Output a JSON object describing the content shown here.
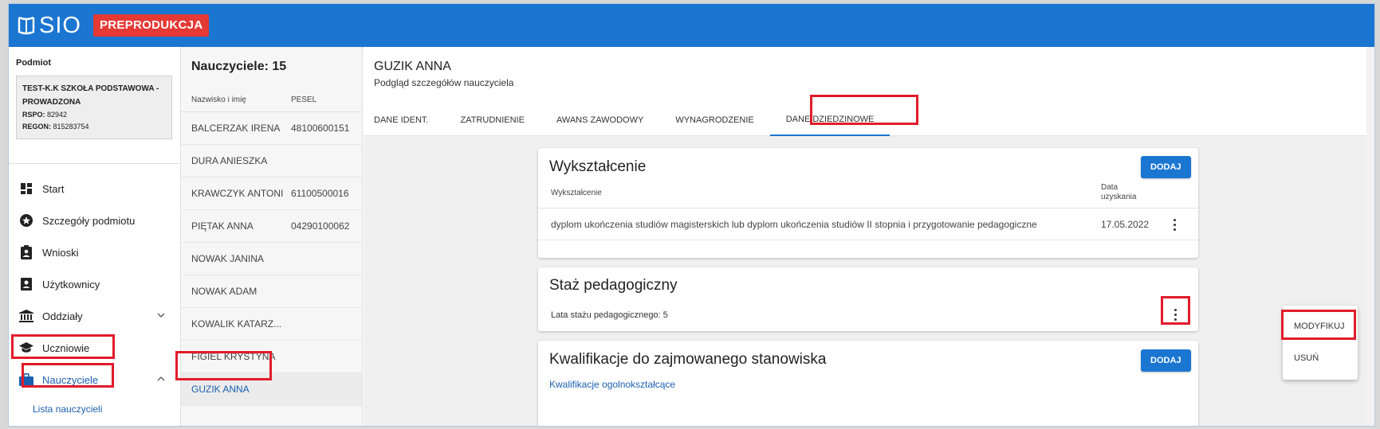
{
  "app": {
    "name": "SIO",
    "environment": "PREPRODUKCJA"
  },
  "sidebar": {
    "podmiot_label": "Podmiot",
    "school_name": "TEST-K.K SZKOŁA PODSTAWOWA - PROWADZONA",
    "rspo_label": "RSPO:",
    "rspo_value": "82942",
    "regon_label": "REGON:",
    "regon_value": "815283754",
    "items": [
      {
        "label": "Start",
        "icon": "dashboard-icon"
      },
      {
        "label": "Szczegóły podmiotu",
        "icon": "star-badge-icon"
      },
      {
        "label": "Wnioski",
        "icon": "clipboard-icon"
      },
      {
        "label": "Użytkownicy",
        "icon": "contact-card-icon"
      },
      {
        "label": "Oddziały",
        "icon": "institution-icon",
        "expandable": true
      },
      {
        "label": "Uczniowie",
        "icon": "graduation-cap-icon"
      },
      {
        "label": "Nauczyciele",
        "icon": "briefcase-icon",
        "expanded": true
      }
    ],
    "subitem": "Lista nauczycieli"
  },
  "teacher_list": {
    "title": "Nauczyciele: 15",
    "col_name": "Nazwisko i imię",
    "col_pesel": "PESEL",
    "rows": [
      {
        "name": "BALCERZAK IRENA",
        "pesel": "48100600151"
      },
      {
        "name": "DURA ANIESZKA",
        "pesel": ""
      },
      {
        "name": "KRAWCZYK ANTONI",
        "pesel": "61100500016"
      },
      {
        "name": "PIĘTAK ANNA",
        "pesel": "04290100062"
      },
      {
        "name": "NOWAK JANINA",
        "pesel": ""
      },
      {
        "name": "NOWAK ADAM",
        "pesel": ""
      },
      {
        "name": "KOWALIK KATARZ...",
        "pesel": ""
      },
      {
        "name": "FIGIEL KRYSTYNA",
        "pesel": ""
      },
      {
        "name": "GUZIK ANNA",
        "pesel": "",
        "selected": true
      }
    ]
  },
  "main": {
    "teacher_name": "GUZIK ANNA",
    "subtitle": "Podgląd szczegółów nauczyciela",
    "tabs": [
      {
        "label": "DANE IDENT."
      },
      {
        "label": "ZATRUDNIENIE"
      },
      {
        "label": "AWANS ZAWODOWY"
      },
      {
        "label": "WYNAGRODZENIE"
      },
      {
        "label": "DANE DZIEDZINOWE",
        "active": true
      }
    ],
    "education": {
      "title": "Wykształcenie",
      "add_label": "DODAJ",
      "col_1": "Wykształcenie",
      "col_2": "Data uzyskania",
      "row_desc": "dyplom ukończenia studiów magisterskich lub dyplom ukończenia studiów II stopnia i przygotowanie pedagogiczne",
      "row_date": "17.05.2022"
    },
    "staz": {
      "title": "Staż pedagogiczny",
      "text": "Lata stażu pedagogicznego: 5"
    },
    "kwalifikacje": {
      "title": "Kwalifikacje do zajmowanego stanowiska",
      "add_label": "DODAJ",
      "link": "Kwalifikacje ogolnokształcące"
    },
    "context_menu": [
      "MODYFIKUJ",
      "USUŃ"
    ]
  },
  "colors": {
    "primary": "#1b76d2",
    "badge": "#e53935",
    "highlight": "#e21b2a"
  }
}
